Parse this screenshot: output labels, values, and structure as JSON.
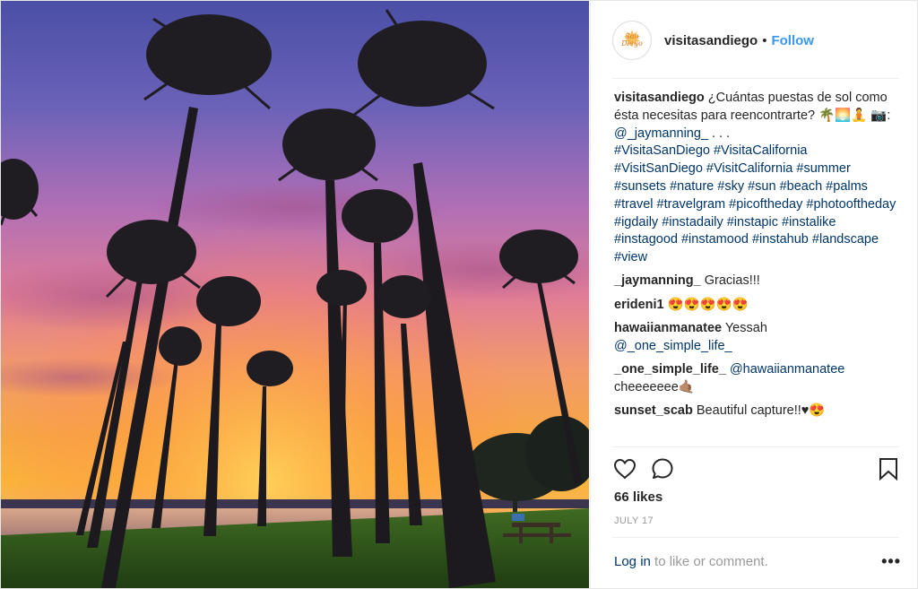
{
  "post": {
    "username": "visitasandiego",
    "follow_label": "Follow",
    "separator": "•",
    "avatar_logo_text": "San Diego",
    "caption": {
      "username": "visitasandiego",
      "line1": "¿Cuántas puestas de sol como ésta necesitas para reencontrarte? 🌴🌅🧘 📷: ",
      "mention": "@_jaymanning_",
      "ellipsis": " . . .",
      "hashtags": "#VisitaSanDiego #VisitaCalifornia #VisitSanDiego #VisitCalifornia #summer #sunsets #nature #sky #sun #beach #palms #travel #travelgram #picoftheday #photooftheday #igdaily #instadaily #instapic #instalike #instagood #instamood #instahub #landscape #view"
    },
    "comments": [
      {
        "user": "_jaymanning_",
        "text": " Gracias!!!",
        "mention": "",
        "after": ""
      },
      {
        "user": "erideni1",
        "text": " 😍😍😍😍😍",
        "mention": "",
        "after": ""
      },
      {
        "user": "hawaiianmanatee",
        "text": " Yessah ",
        "mention": "@_one_simple_life_",
        "after": ""
      },
      {
        "user": "_one_simple_life_",
        "text": " ",
        "mention": "@hawaiianmanatee",
        "after": " cheeeeeee🤙🏽"
      },
      {
        "user": "sunset_scab",
        "text": " Beautiful capture!!♥😍",
        "mention": "",
        "after": ""
      }
    ],
    "likes": "66 likes",
    "date": "JULY 17",
    "footer": {
      "login_label": "Log in",
      "login_suffix": " to like or comment.",
      "more_label": "•••"
    }
  },
  "icons": {
    "like": "heart-icon",
    "comment": "comment-icon",
    "save": "bookmark-icon",
    "more": "more-options-icon"
  },
  "colors": {
    "link_blue": "#3897f0",
    "hashtag": "#003569",
    "muted": "#999999",
    "text": "#262626",
    "border": "#efefef"
  }
}
